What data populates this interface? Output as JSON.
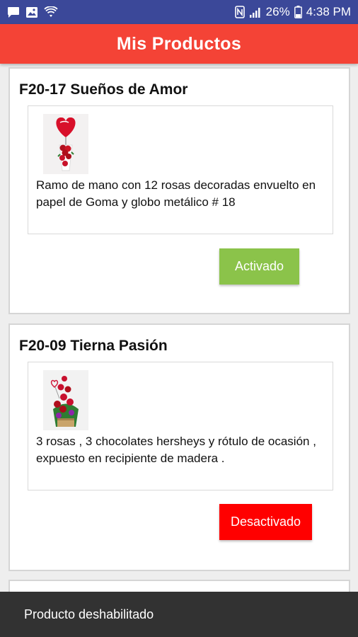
{
  "status_bar": {
    "battery": "26%",
    "time": "4:38 PM",
    "icons_left": [
      "chat-icon",
      "image-icon",
      "wifi-icon"
    ],
    "icons_right": [
      "nfc-icon",
      "signal-icon",
      "battery-icon"
    ]
  },
  "app_bar": {
    "title": "Mis Productos"
  },
  "products": [
    {
      "code_name": "F20-17 Sueños de Amor",
      "description": "Ramo de mano con 12 rosas decoradas envuelto en papel de Goma y globo metálico # 18",
      "status_label": "Activado",
      "status_color": "#8bc34a"
    },
    {
      "code_name": "F20-09 Tierna Pasión",
      "description": "3 rosas , 3 chocolates hersheys y rótulo de ocasión , expuesto en recipiente de madera .",
      "status_label": "Desactivado",
      "status_color": "#ff0000"
    }
  ],
  "snackbar": {
    "message": "Producto deshabilitado"
  },
  "colors": {
    "status_bar": "#3b4899",
    "app_bar": "#f44336",
    "snackbar": "#323232"
  }
}
